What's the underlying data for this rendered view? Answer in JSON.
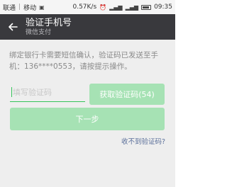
{
  "status_bar": {
    "carrier": "联通",
    "network": "移动",
    "speed": "0.57K/s",
    "time": "09:35"
  },
  "header": {
    "title": "验证手机号",
    "subtitle": "微信支付"
  },
  "main": {
    "description": "绑定银行卡需要短信确认，验证码已发送至手机：136****0553，请按提示操作。",
    "code_placeholder": "填写验证码",
    "get_code_label": "获取验证码(54)",
    "next_label": "下一步",
    "no_code_link": "收不到验证码?"
  },
  "colors": {
    "accent": "#35c35a",
    "disabled_button": "#a6e2b4",
    "header_bg": "#39393d"
  }
}
